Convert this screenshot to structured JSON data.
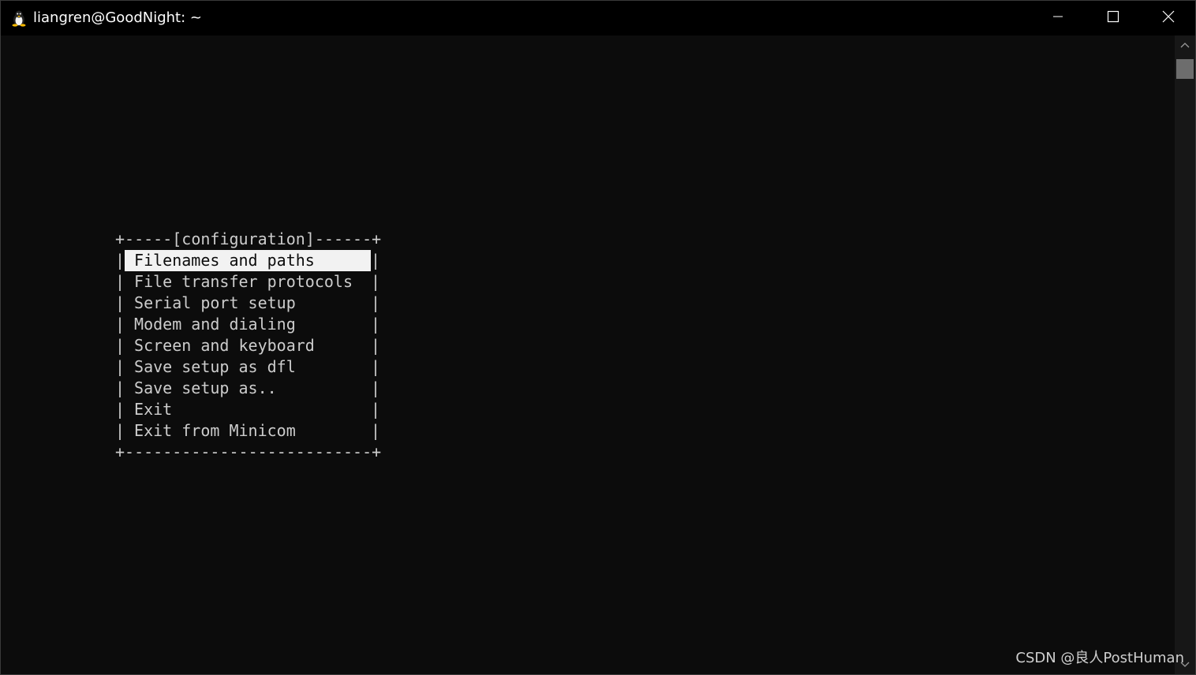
{
  "window": {
    "title": "liangren@GoodNight: ~",
    "icon": "linux-penguin-icon",
    "controls": [
      "minimize-icon",
      "maximize-icon",
      "close-icon"
    ]
  },
  "menu": {
    "top_border": "+-----[configuration]------+",
    "bottom_border": "+--------------------------+",
    "selected_index": 0,
    "items": [
      {
        "label": "Filenames and paths"
      },
      {
        "label": "File transfer protocols"
      },
      {
        "label": "Serial port setup"
      },
      {
        "label": "Modem and dialing"
      },
      {
        "label": "Screen and keyboard"
      },
      {
        "label": "Save setup as dfl"
      },
      {
        "label": "Save setup as.."
      },
      {
        "label": "Exit"
      },
      {
        "label": "Exit from Minicom"
      }
    ]
  },
  "watermark": "CSDN @良人PostHuman",
  "colors": {
    "background": "#0c0c0c",
    "text": "#cccccc",
    "highlight": "#f2f2f2"
  }
}
